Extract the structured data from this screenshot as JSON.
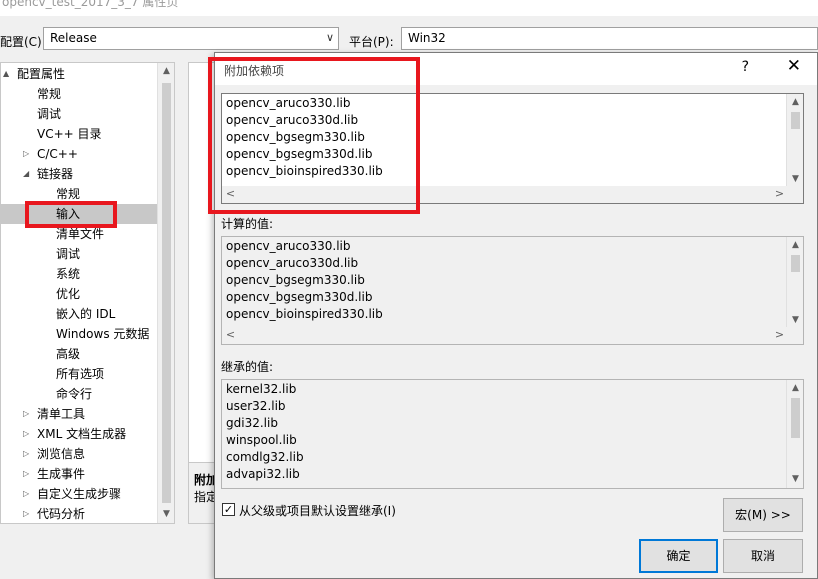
{
  "window": {
    "title": "opencv_test_2017_3_7 属性页"
  },
  "toolbar": {
    "config_label": "配置(C):",
    "config_value": "Release",
    "platform_label": "平台(P):",
    "platform_value": "Win32"
  },
  "tree": {
    "items": [
      {
        "label": "配置属性",
        "expander": "▲"
      },
      {
        "label": "常规"
      },
      {
        "label": "调试"
      },
      {
        "label": "VC++ 目录"
      },
      {
        "label": "C/C++",
        "expander": "▷"
      },
      {
        "label": "链接器",
        "expander": "◢"
      },
      {
        "label": "常规"
      },
      {
        "label": "输入"
      },
      {
        "label": "清单文件"
      },
      {
        "label": "调试"
      },
      {
        "label": "系统"
      },
      {
        "label": "优化"
      },
      {
        "label": "嵌入的 IDL"
      },
      {
        "label": "Windows 元数据"
      },
      {
        "label": "高级"
      },
      {
        "label": "所有选项"
      },
      {
        "label": "命令行"
      },
      {
        "label": "清单工具",
        "expander": "▷"
      },
      {
        "label": "XML 文档生成器",
        "expander": "▷"
      },
      {
        "label": "浏览信息",
        "expander": "▷"
      },
      {
        "label": "生成事件",
        "expander": "▷"
      },
      {
        "label": "自定义生成步骤",
        "expander": "▷"
      },
      {
        "label": "代码分析",
        "expander": "▷"
      }
    ]
  },
  "description": {
    "title": "附加",
    "text": "指定"
  },
  "dialog": {
    "title": "附加依赖项",
    "help": "?",
    "close": "✕",
    "edit_lines": [
      "opencv_aruco330.lib",
      "opencv_aruco330d.lib",
      "opencv_bgsegm330.lib",
      "opencv_bgsegm330d.lib",
      "opencv_bioinspired330.lib"
    ],
    "computed_label": "计算的值:",
    "computed_lines": [
      "opencv_aruco330.lib",
      "opencv_aruco330d.lib",
      "opencv_bgsegm330.lib",
      "opencv_bgsegm330d.lib",
      "opencv_bioinspired330.lib"
    ],
    "inherited_label": "继承的值:",
    "inherited_lines": [
      "kernel32.lib",
      "user32.lib",
      "gdi32.lib",
      "winspool.lib",
      "comdlg32.lib",
      "advapi32.lib"
    ],
    "inherit_checkbox": "从父级或项目默认设置继承(I)",
    "inherit_checked": true,
    "macro_button": "宏(M) >>",
    "ok_button": "确定",
    "cancel_button": "取消"
  },
  "colors": {
    "highlight": "#e8171e",
    "selection": "#c8c8c8",
    "focus": "#0078d7"
  },
  "icons": {
    "checkmark": "✓",
    "scroll_up": "▲",
    "scroll_down": "▼",
    "scroll_left": "<",
    "scroll_right": ">",
    "dropdown": "∨"
  }
}
